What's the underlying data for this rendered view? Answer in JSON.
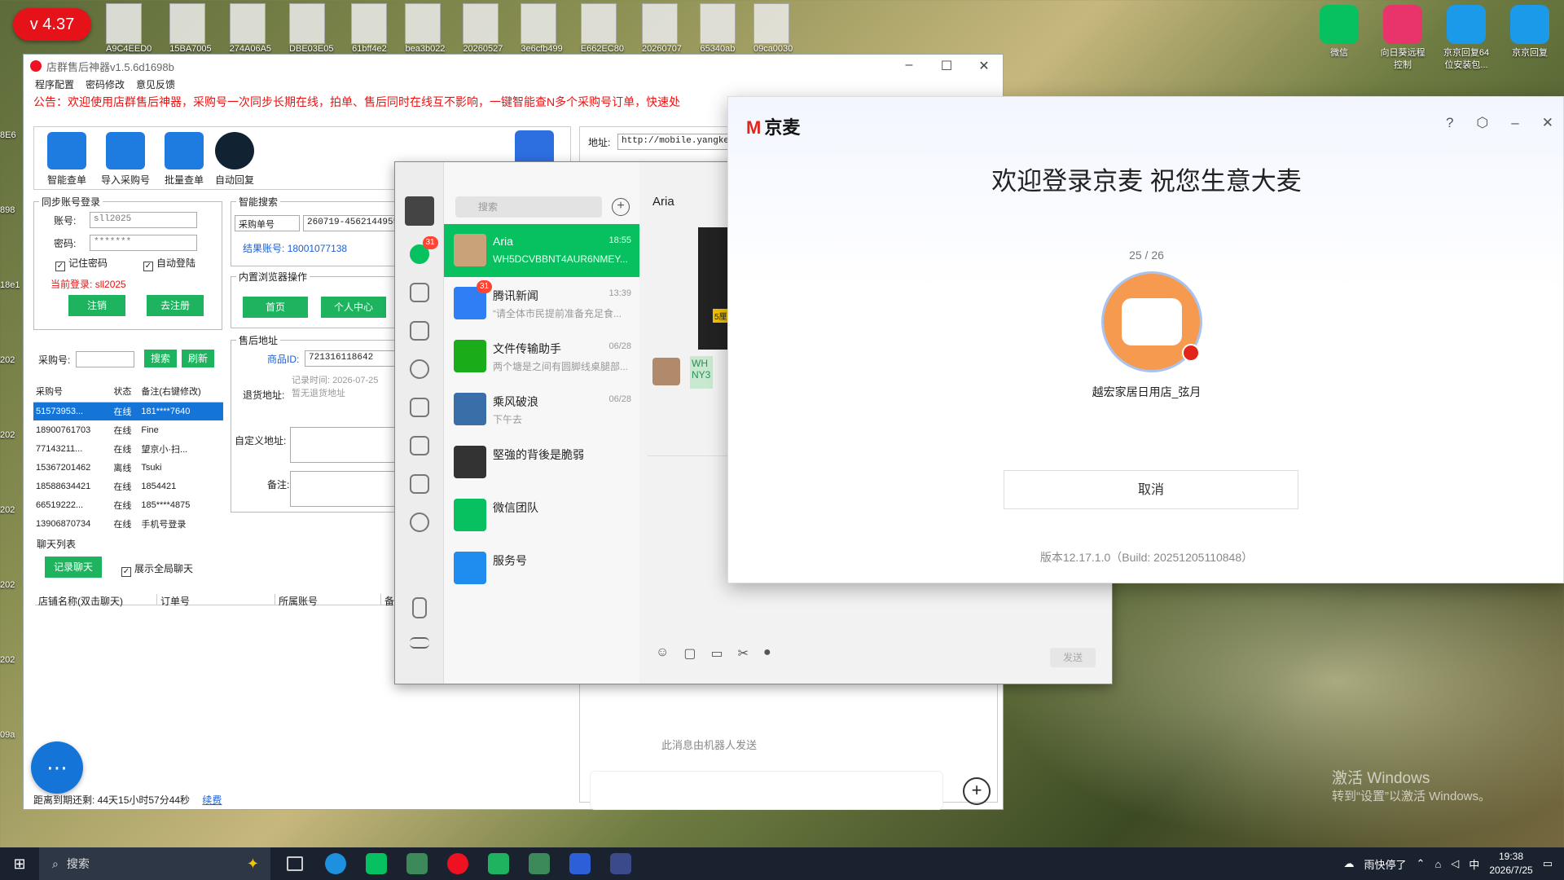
{
  "version_badge": "v 4.37",
  "desktop_top_labels": [
    "A9C4EED0",
    "15BA7005",
    "274A06A5",
    "DBE03E05",
    "61bff4e2",
    "bea3b022",
    "20260527",
    "3e6cfb499",
    "E662EC80",
    "20260707",
    "65340ab",
    "09ca0030"
  ],
  "desktop_left_labels": [
    "8E6",
    "898",
    "18e1",
    "202",
    "202",
    "202",
    "202",
    "202",
    "09a"
  ],
  "desktop_right_icons": [
    {
      "label": "微信",
      "icon": "wechat-icon",
      "color": "#07c160"
    },
    {
      "label": "向日葵远程控制",
      "icon": "sunflower-remote-icon",
      "color": "#e8336b"
    },
    {
      "label": "京京回复64位安装包...",
      "icon": "jd-reply-icon",
      "color": "#1a9ae8"
    },
    {
      "label": "京京回复",
      "icon": "jd-reply-icon",
      "color": "#1a9ae8"
    }
  ],
  "activate_windows": {
    "line1": "激活 Windows",
    "line2": "转到“设置”以激活 Windows。"
  },
  "tool_window": {
    "title": "店群售后神器v1.5.6d1698b",
    "menu": [
      "程序配置",
      "密码修改",
      "意见反馈"
    ],
    "notice": "公告：欢迎使用店群售后神器，采购号一次同步长期在线，拍单、售后同时在线互不影响，一键智能查N多个采购号订单，快速处",
    "toolbar": [
      "智能查单",
      "导入采购号",
      "批量查单",
      "自动回复"
    ],
    "login_group": {
      "title": "同步账号登录",
      "account_label": "账号:",
      "account_value": "sll2025",
      "password_label": "密码:",
      "password_value": "*******",
      "remember": "记住密码",
      "auto_login": "自动登陆",
      "current_login_label": "当前登录:",
      "current_login_value": "sll2025",
      "logout_btn": "注销",
      "register_btn": "去注册"
    },
    "smart_search": {
      "title": "智能搜索",
      "select_value": "采购单号",
      "input_value": "260719-45621449552",
      "result_label": "结果账号:",
      "result_value": "18001077138"
    },
    "browser_ops": {
      "title": "内置浏览器操作",
      "home_btn": "首页",
      "profile_btn": "个人中心"
    },
    "purchase_search": {
      "label": "采购号:",
      "search_btn": "搜索",
      "refresh_btn": "刷新"
    },
    "accounts_table": {
      "headers": [
        "采购号",
        "状态",
        "备注(右键修改)"
      ],
      "rows": [
        [
          "51573953...",
          "在线",
          "181****7640"
        ],
        [
          "18900761703",
          "在线",
          "Fine"
        ],
        [
          "77143211...",
          "在线",
          "望京小·扫..."
        ],
        [
          "15367201462",
          "离线",
          "Tsuki"
        ],
        [
          "18588634421",
          "在线",
          "1854421"
        ],
        [
          "66519222...",
          "在线",
          "185****4875"
        ],
        [
          "13906870734",
          "在线",
          "手机号登录"
        ]
      ]
    },
    "after_sale": {
      "title": "售后地址",
      "goods_id_label": "商品ID:",
      "goods_id_value": "721316118642",
      "record_time": "记录时间: 2026-07-25",
      "return_label": "退货地址:",
      "return_value": "暂无退货地址",
      "custom_label": "自定义地址:",
      "remark_label": "备注:"
    },
    "chat_list": {
      "title": "聊天列表",
      "record_btn": "记录聊天",
      "show_all": "展示全局聊天",
      "headers": [
        "店铺名称(双击聊天)",
        "订单号",
        "所属账号",
        "备"
      ]
    },
    "status": {
      "expire_text": "距离到期还剩: 44天15小时57分44秒",
      "renew_link": "续费"
    },
    "browser": {
      "address_label": "地址:",
      "address_value": "http://mobile.yangkeduo",
      "bottom_hint": "此消息由机器人发送"
    }
  },
  "wechat": {
    "search_placeholder": "搜索",
    "badge_count": "31",
    "chat_title": "Aria",
    "conversations": [
      {
        "name": "Aria",
        "time": "18:55",
        "preview": "WH5DCVBBNT4AUR6NMEY...",
        "color": "#c9a27a"
      },
      {
        "name": "腾讯新闻",
        "time": "13:39",
        "preview": "“请全体市民提前准备充足食...",
        "color": "#2f7ef5",
        "badge": "31"
      },
      {
        "name": "文件传输助手",
        "time": "06/28",
        "preview": "两个塘是之间有圆脚线桌腿部...",
        "color": "#1aad19"
      },
      {
        "name": "乘风破浪",
        "time": "06/28",
        "preview": "下午去",
        "color": "#3a6ea8"
      },
      {
        "name": "堅強的背後是脆弱",
        "time": "",
        "preview": "",
        "color": "#333"
      },
      {
        "name": "微信团队",
        "time": "",
        "preview": "",
        "color": "#07c160"
      },
      {
        "name": "服务号",
        "time": "",
        "preview": "",
        "color": "#1f8cf0"
      }
    ],
    "bubble_text": "WH NY3",
    "image_caption": "5厘",
    "send_btn": "发送"
  },
  "jingmai": {
    "logo_text": "京麦",
    "title": "欢迎登录京麦 祝您生意大麦",
    "page": "25 / 26",
    "shop_name": "越宏家居日用店_弦月",
    "cancel_btn": "取消",
    "version": "版本12.17.1.0（Build: 20251205110848）"
  },
  "taskbar": {
    "search_text": "搜索",
    "weather": "雨快停了",
    "time": "19:38",
    "date": "2026/7/25",
    "ime": "中"
  }
}
